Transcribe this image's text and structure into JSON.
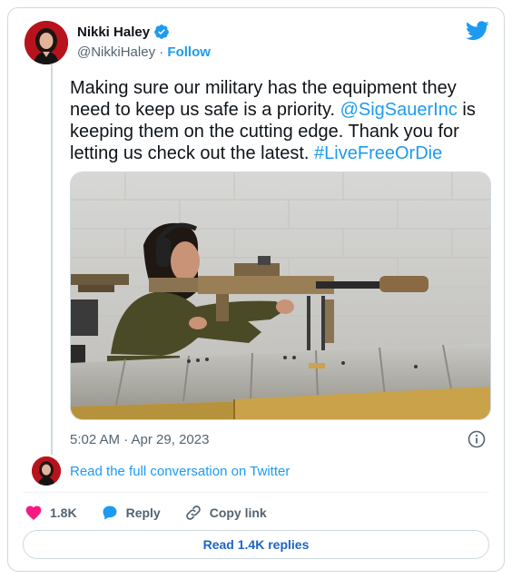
{
  "author": {
    "display_name": "Nikki Haley",
    "handle": "@NikkiHaley",
    "separator": " · ",
    "follow_label": "Follow",
    "verified": true
  },
  "tweet": {
    "text_part1": "Making sure our military has the equipment they need to keep us safe is a priority. ",
    "mention": "@SigSauerInc",
    "text_part2": " is keeping them on the cutting edge. Thank you for letting us check out the latest. ",
    "hashtag": "#LiveFreeOrDie",
    "timestamp": "5:02 AM · Apr 29, 2023"
  },
  "conversation": {
    "read_full_label": "Read the full conversation on Twitter"
  },
  "actions": {
    "likes_count": "1.8K",
    "reply_label": "Reply",
    "copy_link_label": "Copy link"
  },
  "footer": {
    "read_replies_label": "Read 1.4K replies"
  },
  "colors": {
    "accent": "#1d9bf0",
    "like": "#f91880",
    "muted": "#536471",
    "text": "#0f1419"
  },
  "icons": [
    "verified-badge-icon",
    "twitter-bird-icon",
    "info-icon",
    "heart-icon",
    "reply-bubble-icon",
    "copy-link-icon"
  ]
}
